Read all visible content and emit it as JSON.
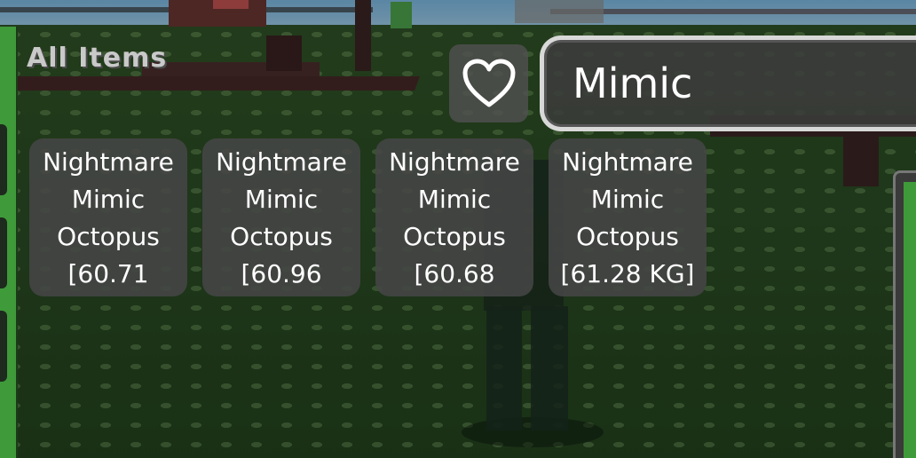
{
  "inventory": {
    "section_title": "All Items",
    "favorite_icon": "heart-outline-icon",
    "search": {
      "value": "Mimic",
      "placeholder": ""
    },
    "items": [
      {
        "label": "Nightmare\nMimic\nOctopus\n[60.71"
      },
      {
        "label": "Nightmare\nMimic\nOctopus\n[60.96"
      },
      {
        "label": "Nightmare\nMimic\nOctopus\n[60.68"
      },
      {
        "label": "Nightmare\nMimic\nOctopus\n[61.28 KG]"
      }
    ]
  },
  "colors": {
    "card_bg": "#464646",
    "text": "#ffffff",
    "title_text": "#c9c9c9",
    "search_border": "#d8d8d8",
    "ground": "#27451f"
  }
}
